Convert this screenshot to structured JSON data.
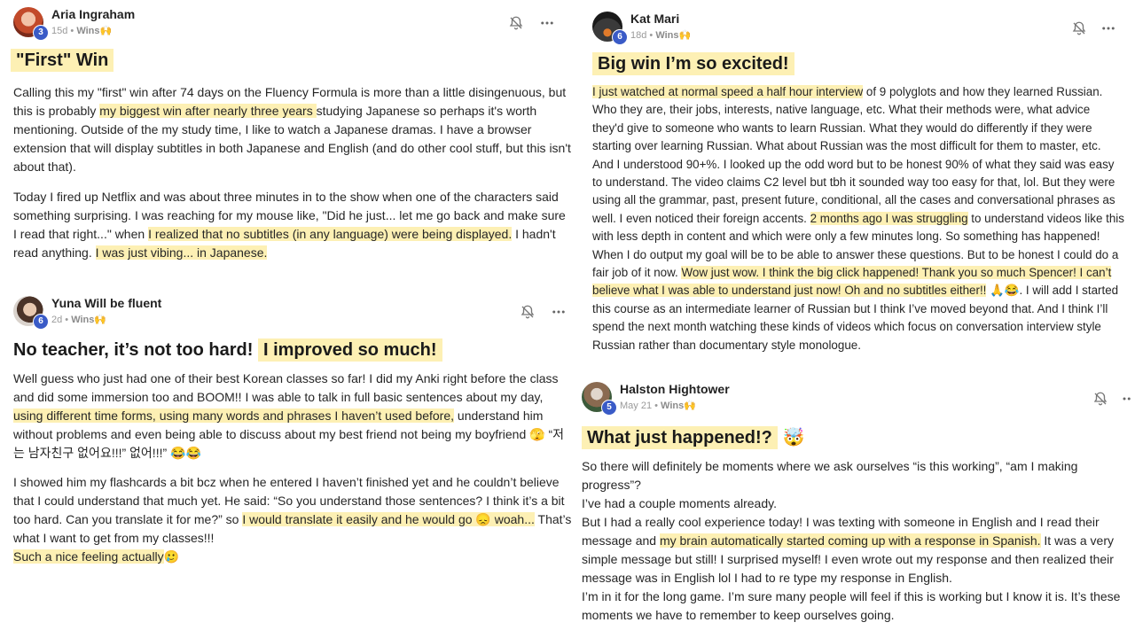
{
  "posts": [
    {
      "author": "Aria Ingraham",
      "level": "3",
      "age": "15d",
      "category": "Wins🙌",
      "title": "\"First\" Win",
      "p1a": "Calling this my \"first\" win after 74 days on the Fluency Formula is more than a little disingenuous, but this is probably ",
      "p1hl": "my biggest win after nearly three years ",
      "p1b": "studying Japanese so perhaps it's worth mentioning. Outside of the my study time, I like to watch a Japanese dramas. I have a browser extension that will display subtitles in both Japanese and English (and do other cool stuff, but this isn't about that).",
      "p2a": "Today I fired up Netflix and was about three minutes in to the show when one of the characters said something surprising. I was reaching for my mouse like, \"Did he just... let me go back and make sure I read that right...\" when ",
      "p2hl1": "I realized that no subtitles (in any language) were being displayed.",
      "p2b": " I hadn't read anything. ",
      "p2hl2": "I was just vibing... in Japanese."
    },
    {
      "author": "Yuna Will be fluent",
      "level": "6",
      "age": "2d",
      "category": "Wins🙌",
      "title_plain": "No teacher, it’s not too hard! ",
      "title_hl": "I improved so much!",
      "p1a": "Well guess who just had one of their best Korean classes so far! I did my Anki right before the class and did some immersion too and BOOM!! I was able to talk in full basic sentences about my day, ",
      "p1hl": "using different time forms, using many words and phrases I haven’t used before,",
      "p1b": " understand him without problems and even being able to discuss about my best friend not being my boyfriend 🫣 “저는 남자친구 없어요!!!” 없어!!!” 😂😂",
      "p2a": "I showed him my flashcards a bit bcz when he entered I haven’t finished yet and he couldn’t believe that I could understand that much yet. He said: “So you understand those sentences? I think it’s a bit too hard. Can you translate it for me?” so ",
      "p2hl": "I would translate it easily and he would go 😞 woah...",
      "p2b": " That’s what I want to get from my classes!!!",
      "p3hl": "Such a nice feeling actually",
      "p3emoji": "🥲"
    },
    {
      "author": "Kat Mari",
      "level": "6",
      "age": "18d",
      "category": "Wins🙌",
      "title": "Big win I’m so excited!",
      "p1hl1": "I just watched at normal speed a half hour interview",
      "p1a": " of 9 polyglots and how they learned Russian. Who they are, their jobs, interests, native language, etc. What their methods were, what advice they'd give to someone who wants to learn Russian. What they would do differently if they were starting over learning Russian. What about Russian was the most difficult for them to master, etc. And I understood 90+%. I looked up the odd word but to be honest 90% of what they said was easy to understand. The video claims C2 level but tbh it sounded way too easy for that, lol. But they were using all the grammar, past, present future, conditional, all the cases and conversational phrases as well. I even noticed their foreign accents. ",
      "p1hl2": "2 months ago I was struggling",
      "p1b": " to understand videos like this with less depth in content and which were only a few minutes long. So something has happened! When I do output my goal will be to be able to answer these questions. But to be honest I could do a fair job of it now. ",
      "p1hl3": "Wow just wow. I think the big click happened! Thank you so much Spencer! I can’t believe what I was able to understand just now! Oh and no subtitles either!!",
      "p1c": " 🙏😂. I will add I started this course as an intermediate learner of Russian but I think I’ve moved beyond that. And I think I’ll spend the next month watching these kinds of videos which focus on conversation interview style Russian rather than documentary style monologue."
    },
    {
      "author": "Halston Hightower",
      "level": "5",
      "age": "May 21",
      "category": "Wins🙌",
      "title": "What just happened!?",
      "title_emoji": "🤯",
      "p1": "So there will definitely be moments where we ask ourselves “is this working”, “am I making progress”?",
      "p2": "I’ve had a couple moments already.",
      "p3a": "But I had a really cool experience today! I was texting with someone in English and I read their message and ",
      "p3hl": "my brain automatically started coming up with a response in Spanish.",
      "p3b": " It was a very simple message but still! I surprised myself! I even wrote out my response and then realized their message was in English lol I had to re type my response in English.",
      "p4": "I’m in it for the long game. I’m sure many people will feel if this is working but I know it is. It’s these moments we have to remember to keep ourselves going."
    }
  ],
  "colors": {
    "highlight": "#fdf0b4",
    "level_badge": "#3a5bc7"
  }
}
